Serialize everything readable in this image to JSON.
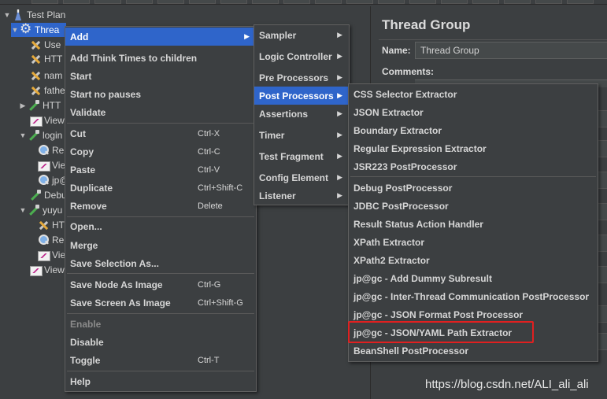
{
  "tree": {
    "nodes": [
      {
        "label": "Test Plan",
        "icon": "flask-icon",
        "arrow": "▼"
      },
      {
        "label": "Threa",
        "icon": "gear-icon",
        "arrow": "▼"
      },
      {
        "label": "Use",
        "icon": "wrench-icon",
        "arrow": ""
      },
      {
        "label": "HTT",
        "icon": "wrench-icon",
        "arrow": ""
      },
      {
        "label": "nam",
        "icon": "wrench-icon",
        "arrow": ""
      },
      {
        "label": "fathe",
        "icon": "wrench-icon",
        "arrow": ""
      },
      {
        "label": "HTT",
        "icon": "pipette-icon",
        "arrow": "▶"
      },
      {
        "label": "View",
        "icon": "chart-icon",
        "arrow": ""
      },
      {
        "label": "login",
        "icon": "pipette-icon",
        "arrow": "▼"
      },
      {
        "label": "Re",
        "icon": "magnify-icon",
        "arrow": ""
      },
      {
        "label": "Vie",
        "icon": "chart-icon",
        "arrow": ""
      },
      {
        "label": "jp@",
        "icon": "magnify-icon",
        "arrow": ""
      },
      {
        "label": "Debu",
        "icon": "pipette-icon",
        "arrow": ""
      },
      {
        "label": "yuyu",
        "icon": "pipette-icon",
        "arrow": "▼"
      },
      {
        "label": "HT",
        "icon": "wrench-icon",
        "arrow": ""
      },
      {
        "label": "Re",
        "icon": "magnify-icon",
        "arrow": ""
      },
      {
        "label": "Vie",
        "icon": "chart-icon",
        "arrow": ""
      },
      {
        "label": "View",
        "icon": "chart-icon",
        "arrow": ""
      }
    ]
  },
  "panel": {
    "title": "Thread Group",
    "name_label": "Name:",
    "name_value": "Thread Group",
    "comments_label": "Comments:"
  },
  "context_menu": {
    "items": [
      {
        "label": "Add",
        "shortcut": "",
        "submenu": true,
        "active": true
      },
      {
        "label": "Add Think Times to children",
        "shortcut": ""
      },
      {
        "label": "Start",
        "shortcut": ""
      },
      {
        "label": "Start no pauses",
        "shortcut": ""
      },
      {
        "label": "Validate",
        "shortcut": ""
      },
      {
        "label": "Cut",
        "shortcut": "Ctrl-X"
      },
      {
        "label": "Copy",
        "shortcut": "Ctrl-C"
      },
      {
        "label": "Paste",
        "shortcut": "Ctrl-V"
      },
      {
        "label": "Duplicate",
        "shortcut": "Ctrl+Shift-C"
      },
      {
        "label": "Remove",
        "shortcut": "Delete"
      },
      {
        "label": "Open...",
        "shortcut": ""
      },
      {
        "label": "Merge",
        "shortcut": ""
      },
      {
        "label": "Save Selection As...",
        "shortcut": ""
      },
      {
        "label": "Save Node As Image",
        "shortcut": "Ctrl-G"
      },
      {
        "label": "Save Screen As Image",
        "shortcut": "Ctrl+Shift-G"
      },
      {
        "label": "Enable",
        "shortcut": "",
        "disabled": true
      },
      {
        "label": "Disable",
        "shortcut": ""
      },
      {
        "label": "Toggle",
        "shortcut": "Ctrl-T"
      },
      {
        "label": "Help",
        "shortcut": ""
      }
    ]
  },
  "add_submenu": {
    "items": [
      {
        "label": "Sampler"
      },
      {
        "label": "Logic Controller"
      },
      {
        "label": "Pre Processors"
      },
      {
        "label": "Post Processors",
        "active": true
      },
      {
        "label": "Assertions"
      },
      {
        "label": "Timer"
      },
      {
        "label": "Test Fragment"
      },
      {
        "label": "Config Element"
      },
      {
        "label": "Listener"
      }
    ],
    "arrow": "▶"
  },
  "post_processors_submenu": {
    "items": [
      {
        "label": "CSS Selector Extractor"
      },
      {
        "label": "JSON Extractor"
      },
      {
        "label": "Boundary Extractor"
      },
      {
        "label": "Regular Expression Extractor"
      },
      {
        "label": "JSR223 PostProcessor"
      },
      {
        "label": "Debug PostProcessor"
      },
      {
        "label": "JDBC PostProcessor"
      },
      {
        "label": "Result Status Action Handler"
      },
      {
        "label": "XPath Extractor"
      },
      {
        "label": "XPath2 Extractor"
      },
      {
        "label": "jp@gc - Add Dummy Subresult"
      },
      {
        "label": "jp@gc - Inter-Thread Communication PostProcessor"
      },
      {
        "label": "jp@gc - JSON Format Post Processor"
      },
      {
        "label": "jp@gc - JSON/YAML Path Extractor",
        "highlighted": true
      },
      {
        "label": "BeanShell PostProcessor"
      }
    ]
  },
  "watermark": "https://blog.csdn.net/ALI_ali_ali",
  "colors": {
    "background": "#3c3f41",
    "selection": "#2f65ca",
    "highlight_box": "#e02020"
  }
}
